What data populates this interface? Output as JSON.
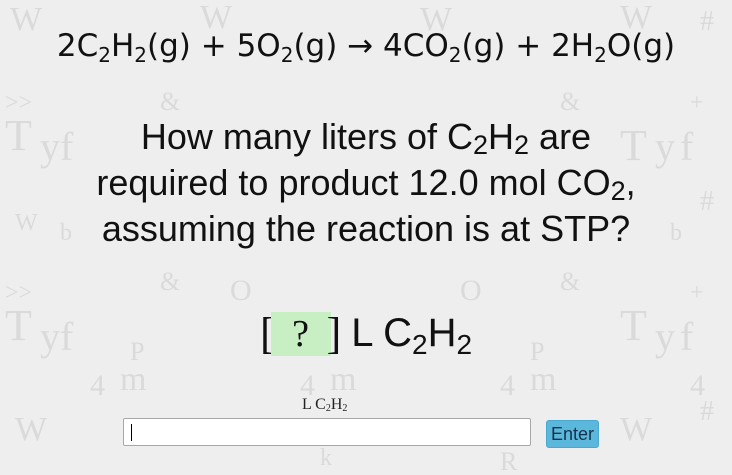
{
  "equation": {
    "parts": [
      "2C",
      "2",
      "H",
      "2",
      "(g) + 5O",
      "2",
      "(g) → 4CO",
      "2",
      "(g) + 2H",
      "2",
      "O(g)"
    ]
  },
  "question": {
    "line1_a": "How many liters of C",
    "line1_sub1": "2",
    "line1_b": "H",
    "line1_sub2": "2",
    "line1_c": " are",
    "line2_a": "required to product 12.0 mol CO",
    "line2_sub": "2",
    "line2_b": ",",
    "line3": "assuming the reaction is at STP?"
  },
  "answer_row": {
    "open_bracket": "[",
    "blank": "?",
    "close_bracket": "]",
    "unit_a": "L C",
    "unit_sub1": "2",
    "unit_b": "H",
    "unit_sub2": "2"
  },
  "input": {
    "label_a": "L C",
    "label_sub1": "2",
    "label_b": "H",
    "label_sub2": "2",
    "value": "",
    "placeholder": ""
  },
  "enter_button": {
    "label": "Enter"
  },
  "colors": {
    "background": "#eeeeee",
    "blank_fill": "#c8eec4",
    "button_fill": "#5cb7dc"
  }
}
